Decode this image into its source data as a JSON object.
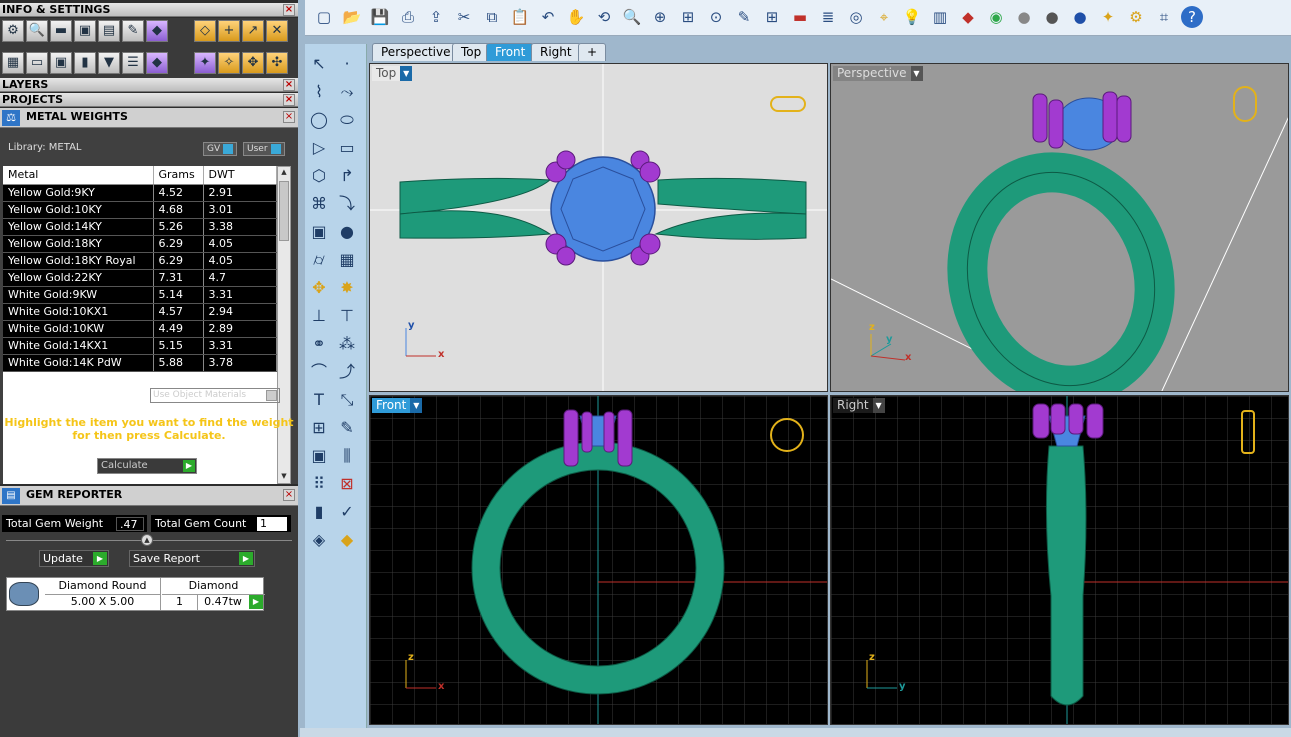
{
  "left_panel": {
    "info_settings_title": "INFO & SETTINGS",
    "layers_title": "LAYERS",
    "projects_title": "PROJECTS",
    "metal_weights": {
      "title": "METAL WEIGHTS",
      "library_label": "Library: METAL",
      "gv_label": "GV",
      "user_label": "User",
      "columns": [
        "Metal",
        "Grams",
        "DWT"
      ],
      "rows": [
        [
          "Yellow Gold:9KY",
          "4.52",
          "2.91"
        ],
        [
          "Yellow Gold:10KY",
          "4.68",
          "3.01"
        ],
        [
          "Yellow Gold:14KY",
          "5.26",
          "3.38"
        ],
        [
          "Yellow Gold:18KY",
          "6.29",
          "4.05"
        ],
        [
          "Yellow Gold:18KY Royal",
          "6.29",
          "4.05"
        ],
        [
          "Yellow Gold:22KY",
          "7.31",
          "4.7"
        ],
        [
          "White Gold:9KW",
          "5.14",
          "3.31"
        ],
        [
          "White Gold:10KX1",
          "4.57",
          "2.94"
        ],
        [
          "White Gold:10KW",
          "4.49",
          "2.89"
        ],
        [
          "White Gold:14KX1",
          "5.15",
          "3.31"
        ],
        [
          "White Gold:14K PdW",
          "5.88",
          "3.78"
        ]
      ],
      "use_object_materials": "Use Object Materials",
      "hint": "Highlight the item you want to find the weight for then press Calculate.",
      "calculate_label": "Calculate"
    },
    "gem_reporter": {
      "title": "GEM REPORTER",
      "total_weight_label": "Total Gem Weight",
      "total_weight_value": ".47",
      "total_count_label": "Total Gem Count",
      "total_count_value": "1",
      "update_label": "Update",
      "save_report_label": "Save Report",
      "gem": {
        "shape": "Diamond Round",
        "size": "5.00 X 5.00",
        "material": "Diamond",
        "count": "1",
        "weight": "0.47tw"
      }
    }
  },
  "tabs": [
    "Perspective",
    "Top",
    "Front",
    "Right",
    "+"
  ],
  "active_tab": "Front",
  "viewports": {
    "top": {
      "label": "Top",
      "axes": [
        "y",
        "x"
      ]
    },
    "perspective": {
      "label": "Perspective",
      "axes": [
        "z",
        "y",
        "x"
      ]
    },
    "front": {
      "label": "Front",
      "axes": [
        "z",
        "x"
      ]
    },
    "right": {
      "label": "Right",
      "axes": [
        "z",
        "y"
      ]
    }
  },
  "colors": {
    "ring": "#1e9a7a",
    "gem": "#4a86e0",
    "prongs": "#a23ad0",
    "accent": "#2f9bd8",
    "grid_bg": "#000000"
  },
  "toolbar_icons": [
    "new-icon",
    "open-icon",
    "save-icon",
    "print-icon",
    "import-icon",
    "cut-icon",
    "copy-icon",
    "paste-icon",
    "undo-icon",
    "pan-icon",
    "rotate-view-icon",
    "zoom-icon",
    "zoom-window-icon",
    "zoom-extents-icon",
    "zoom-selected-icon",
    "properties-icon",
    "four-view-icon",
    "car-icon",
    "layer-icon",
    "point-icon",
    "snap-icon",
    "light-icon",
    "display-icon",
    "render-icon",
    "color-wheel-icon",
    "material-icon",
    "material-dark-icon",
    "sphere-icon",
    "flash-icon",
    "gear-icon",
    "options-icon",
    "help-icon"
  ]
}
